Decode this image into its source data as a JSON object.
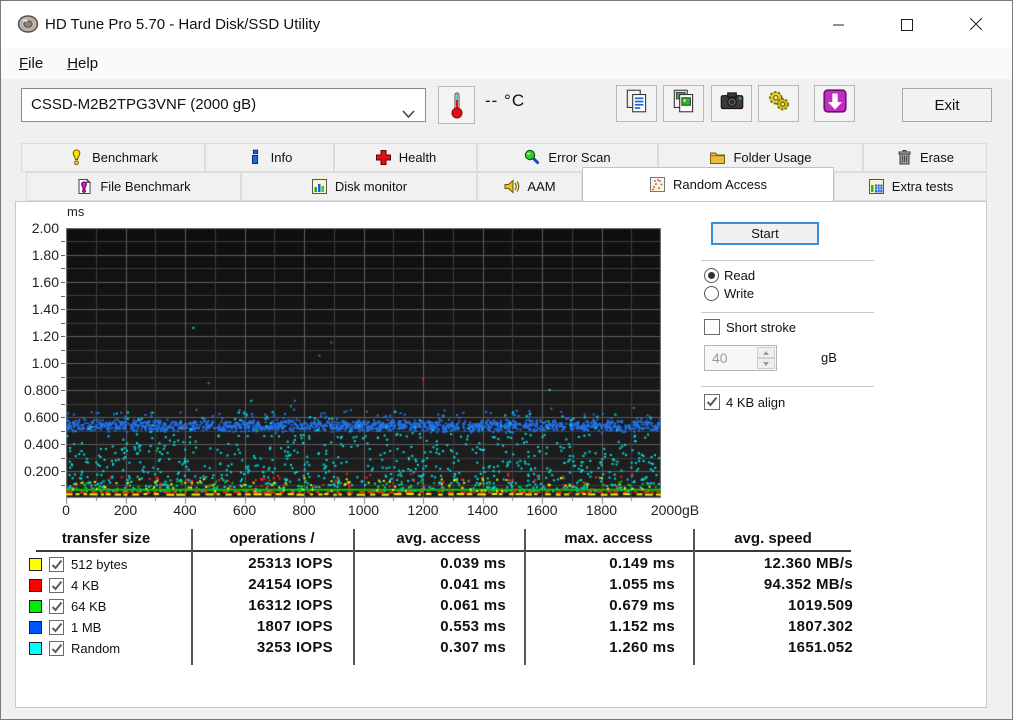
{
  "window": {
    "title": "HD Tune Pro 5.70 - Hard Disk/SSD Utility"
  },
  "menu": {
    "items": [
      {
        "label": "File"
      },
      {
        "label": "Help"
      }
    ]
  },
  "toolbar": {
    "drive": "CSSD-M2B2TPG3VNF (2000 gB)",
    "temperature": "--  °C",
    "exit": "Exit",
    "buttons": [
      {
        "icon": "copy-report-icon"
      },
      {
        "icon": "copy-image-icon"
      },
      {
        "icon": "screenshot-icon"
      },
      {
        "icon": "options-icon"
      },
      {
        "icon": "save-icon"
      }
    ]
  },
  "tabs": {
    "row1": [
      {
        "label": "Benchmark",
        "icon": "benchmark-icon"
      },
      {
        "label": "Info",
        "icon": "info-icon"
      },
      {
        "label": "Health",
        "icon": "health-icon"
      },
      {
        "label": "Error Scan",
        "icon": "error-scan-icon"
      },
      {
        "label": "Folder Usage",
        "icon": "folder-usage-icon"
      },
      {
        "label": "Erase",
        "icon": "erase-icon"
      }
    ],
    "row2": [
      {
        "label": "File Benchmark",
        "icon": "file-benchmark-icon"
      },
      {
        "label": "Disk monitor",
        "icon": "disk-monitor-icon"
      },
      {
        "label": "AAM",
        "icon": "aam-icon"
      },
      {
        "label": "Random Access",
        "icon": "random-access-icon",
        "active": true
      },
      {
        "label": "Extra tests",
        "icon": "extra-tests-icon"
      }
    ]
  },
  "controls": {
    "start": "Start",
    "mode": {
      "options": [
        "Read",
        "Write"
      ],
      "selected": "Read"
    },
    "short_stroke": {
      "label": "Short stroke",
      "checked": false
    },
    "stroke_size": {
      "value": "40",
      "unit": "gB",
      "disabled": true
    },
    "align": {
      "label": "4 KB align",
      "checked": true
    }
  },
  "chart_data": {
    "type": "scatter",
    "title": "Random access time vs disk position",
    "xlabel": "gB",
    "ylabel": "ms",
    "xlim": [
      0,
      2000
    ],
    "ylim": [
      0,
      2.0
    ],
    "x_tick_labels": [
      "0",
      "200",
      "400",
      "600",
      "800",
      "1000",
      "1200",
      "1400",
      "1600",
      "1800",
      "2000gB"
    ],
    "y_tick_labels": [
      "2.00",
      "1.80",
      "1.60",
      "1.40",
      "1.20",
      "1.00",
      "0.800",
      "0.600",
      "0.400",
      "0.200"
    ],
    "grid": {
      "on": true,
      "x_step": 100,
      "y_step": 0.1,
      "x_major": 200,
      "y_major": 0.2
    },
    "background": "#141414",
    "series": [
      {
        "name": "1 MB",
        "color": "#2273ee",
        "pattern": "band",
        "band_center_ms": 0.535,
        "band_sigma_ms": 0.02,
        "upper_scatter_ms": [
          0.56,
          0.68
        ],
        "outliers_ms": [
          0.72,
          0.85,
          1.152
        ],
        "avg_ms": 0.553,
        "max_ms": 1.152
      },
      {
        "name": "Random",
        "color": "#00dede",
        "pattern": "scatter",
        "scatter_range_ms": [
          0.05,
          0.47
        ],
        "mid_scatter_ms": [
          0.45,
          0.64
        ],
        "outliers_ms": [
          0.72,
          0.8,
          1.26
        ],
        "avg_ms": 0.307,
        "max_ms": 1.26
      },
      {
        "name": "64 KB",
        "color": "#00cc00",
        "pattern": "solid-line",
        "line_ms": 0.061,
        "scatter_range_ms": [
          0.07,
          0.13
        ],
        "outliers_ms": [
          0.35,
          0.5,
          0.679
        ],
        "avg_ms": 0.061,
        "max_ms": 0.679
      },
      {
        "name": "4 KB",
        "color": "#ff2222",
        "pattern": "dashed-line",
        "line_ms": 0.044,
        "scatter_range_ms": [
          0.06,
          0.18
        ],
        "outliers_ms": [
          0.52,
          0.88,
          1.055
        ],
        "avg_ms": 0.041,
        "max_ms": 1.055
      },
      {
        "name": "512 bytes",
        "color": "#f2f200",
        "pattern": "dashed-line",
        "line_ms": 0.027,
        "scatter_range_ms": [
          0.05,
          0.149
        ],
        "outliers_ms": [],
        "avg_ms": 0.039,
        "max_ms": 0.149
      }
    ]
  },
  "results_table": {
    "headers": [
      "transfer size",
      "operations /",
      "avg. access",
      "max. access",
      "avg. speed"
    ],
    "rows": [
      {
        "color": "#ffff00",
        "checked": true,
        "label": "512 bytes",
        "operations": "25313 IOPS",
        "avg_access": "0.039 ms",
        "max_access": "0.149 ms",
        "avg_speed": "12.360 MB/s"
      },
      {
        "color": "#ff0000",
        "checked": true,
        "label": "4 KB",
        "operations": "24154 IOPS",
        "avg_access": "0.041 ms",
        "max_access": "1.055 ms",
        "avg_speed": "94.352 MB/s"
      },
      {
        "color": "#00ee00",
        "checked": true,
        "label": "64 KB",
        "operations": "16312 IOPS",
        "avg_access": "0.061 ms",
        "max_access": "0.679 ms",
        "avg_speed": "1019.509"
      },
      {
        "color": "#0055ff",
        "checked": true,
        "label": "1 MB",
        "operations": "1807 IOPS",
        "avg_access": "0.553 ms",
        "max_access": "1.152 ms",
        "avg_speed": "1807.302"
      },
      {
        "color": "#00ffff",
        "checked": true,
        "label": "Random",
        "operations": "3253 IOPS",
        "avg_access": "0.307 ms",
        "max_access": "1.260 ms",
        "avg_speed": "1651.052"
      }
    ]
  }
}
